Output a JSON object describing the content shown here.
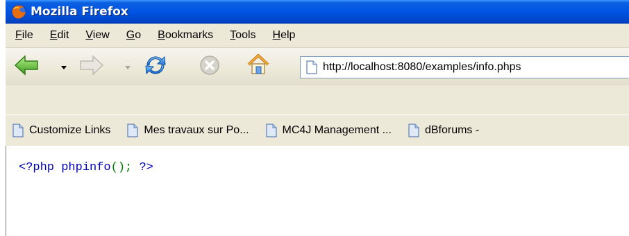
{
  "window": {
    "title": "Mozilla Firefox",
    "app_icon": "firefox-icon"
  },
  "menubar": {
    "items": [
      {
        "label": "File",
        "mnemonic": "F",
        "rest": "ile"
      },
      {
        "label": "Edit",
        "mnemonic": "E",
        "rest": "dit"
      },
      {
        "label": "View",
        "mnemonic": "V",
        "rest": "iew"
      },
      {
        "label": "Go",
        "mnemonic": "G",
        "rest": "o"
      },
      {
        "label": "Bookmarks",
        "mnemonic": "B",
        "rest": "ookmarks"
      },
      {
        "label": "Tools",
        "mnemonic": "T",
        "rest": "ools"
      },
      {
        "label": "Help",
        "mnemonic": "H",
        "rest": "elp"
      }
    ]
  },
  "navbar": {
    "buttons": [
      "back-arrow-icon",
      "forward-arrow-icon",
      "reload-icon",
      "stop-icon",
      "home-icon"
    ],
    "url": "http://localhost:8080/examples/info.phps",
    "url_icon": "page-icon"
  },
  "bookmarks": {
    "items": [
      {
        "label": "Customize Links",
        "icon": "page-icon"
      },
      {
        "label": "Mes travaux sur Po...",
        "icon": "page-icon"
      },
      {
        "label": "MC4J Management ...",
        "icon": "page-icon"
      },
      {
        "label": "dBforums -",
        "icon": "page-icon"
      }
    ]
  },
  "content": {
    "code_open": "<?php",
    "code_func": "phpinfo",
    "code_parens": "();",
    "code_close": "?>",
    "colors": {
      "tag": "#0000bb",
      "keyword": "#007700"
    }
  },
  "colors": {
    "titlebar": "#0054e3",
    "chrome": "#ece9d8"
  }
}
